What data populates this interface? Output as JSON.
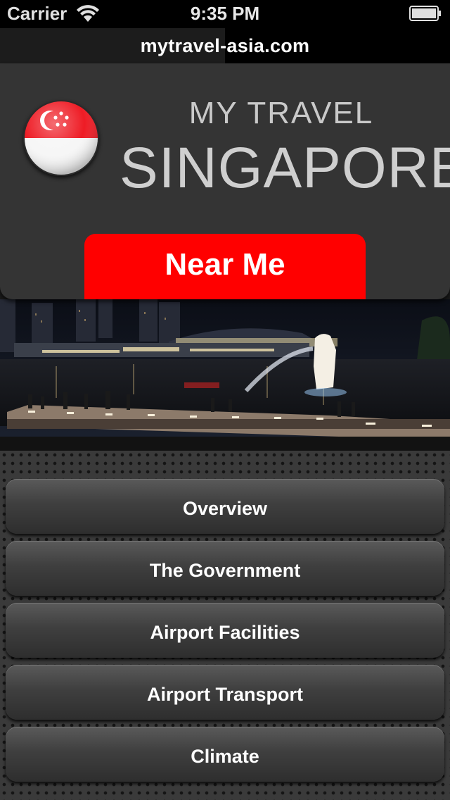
{
  "status_bar": {
    "carrier": "Carrier",
    "time": "9:35 PM",
    "icons": [
      "wifi-icon",
      "battery-icon"
    ]
  },
  "url_bar": {
    "url": "mytravel-asia.com"
  },
  "header": {
    "title_small": "MY TRAVEL",
    "title_large": "SINGAPORE",
    "flag_icon": "singapore-flag-icon",
    "near_me_label": "Near Me"
  },
  "colors": {
    "accent_red": "#ff0000",
    "panel": "#343434",
    "menu_button": "#444444",
    "title_text": "#cfcfcf"
  },
  "menu": {
    "items": [
      {
        "label": "Overview"
      },
      {
        "label": "The Government"
      },
      {
        "label": "Airport Facilities"
      },
      {
        "label": "Airport Transport"
      },
      {
        "label": "Climate"
      }
    ]
  }
}
